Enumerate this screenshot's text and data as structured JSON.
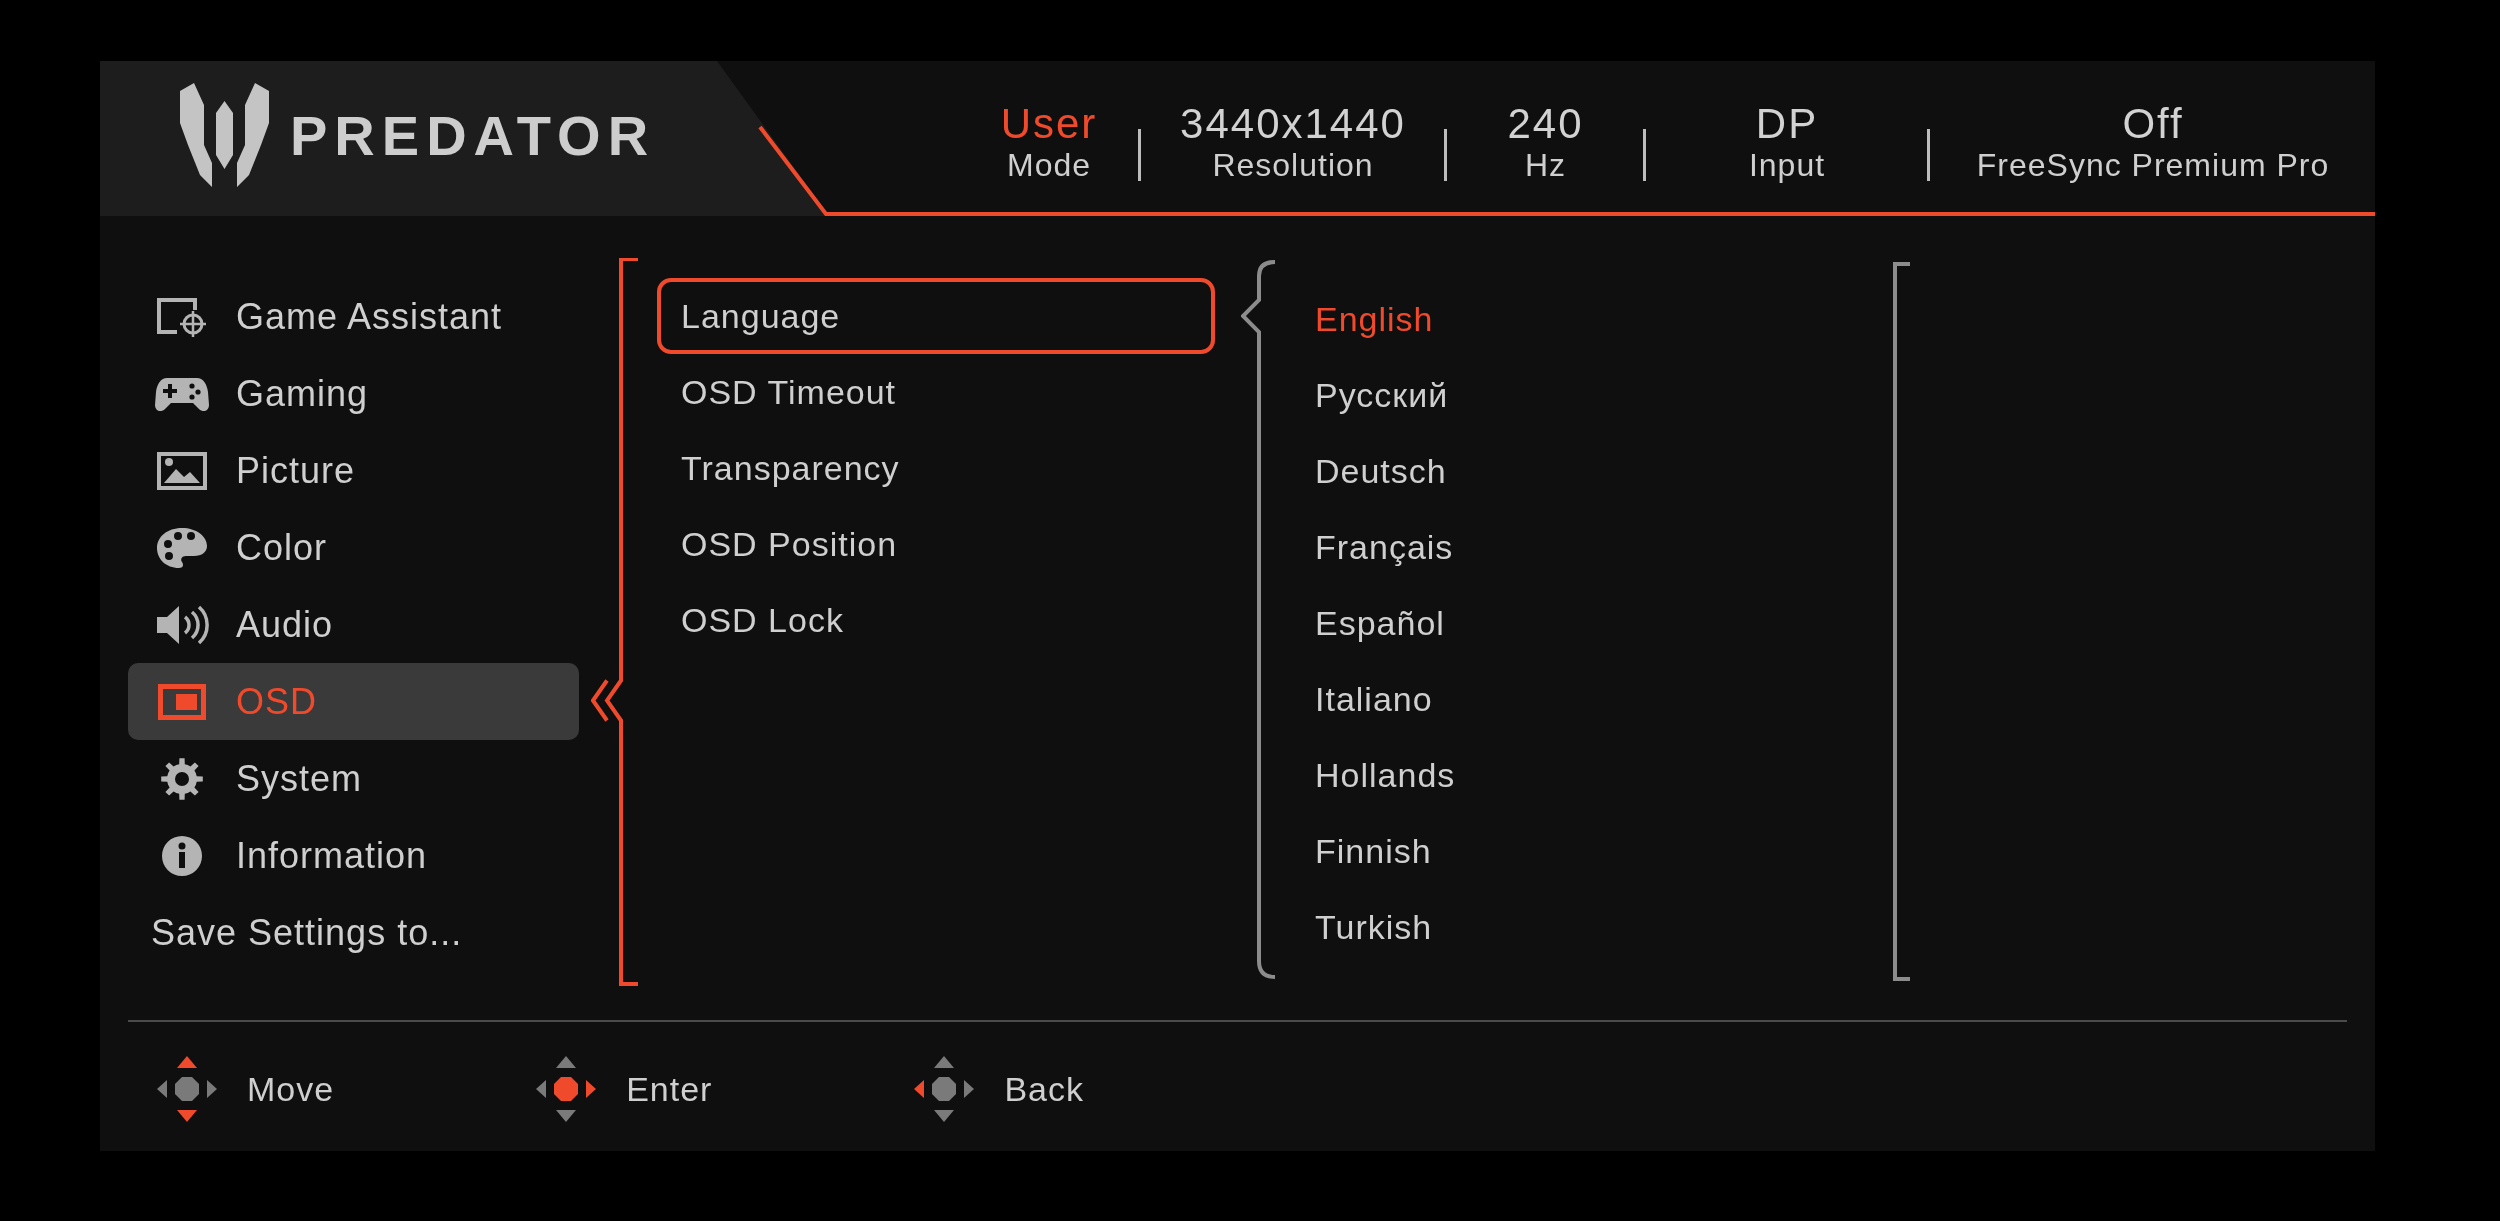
{
  "logo": {
    "wordmark": "PREDATOR"
  },
  "status_bar": [
    {
      "value": "User",
      "label": "Mode",
      "highlighted": true
    },
    {
      "value": "3440x1440",
      "label": "Resolution",
      "highlighted": false
    },
    {
      "value": "240",
      "label": "Hz",
      "highlighted": false
    },
    {
      "value": "DP",
      "label": "Input",
      "highlighted": false
    },
    {
      "value": "Off",
      "label": "FreeSync Premium Pro",
      "highlighted": false
    }
  ],
  "menu": [
    {
      "label": "Game Assistant",
      "kind": "category",
      "selected": false
    },
    {
      "label": "Gaming",
      "kind": "category",
      "selected": false
    },
    {
      "label": "Picture",
      "kind": "category",
      "selected": false
    },
    {
      "label": "Color",
      "kind": "category",
      "selected": false
    },
    {
      "label": "Audio",
      "kind": "category",
      "selected": false
    },
    {
      "label": "OSD",
      "kind": "category",
      "selected": true
    },
    {
      "label": "System",
      "kind": "category",
      "selected": false
    },
    {
      "label": "Information",
      "kind": "category",
      "selected": false
    },
    {
      "label": "Save Settings to...",
      "kind": "action",
      "selected": false
    }
  ],
  "submenu": [
    {
      "label": "Language",
      "selected": true
    },
    {
      "label": "OSD Timeout",
      "selected": false
    },
    {
      "label": "Transparency",
      "selected": false
    },
    {
      "label": "OSD Position",
      "selected": false
    },
    {
      "label": "OSD Lock",
      "selected": false
    }
  ],
  "options": [
    {
      "label": "English",
      "selected": true
    },
    {
      "label": "Русский",
      "selected": false
    },
    {
      "label": "Deutsch",
      "selected": false
    },
    {
      "label": "Français",
      "selected": false
    },
    {
      "label": "Español",
      "selected": false
    },
    {
      "label": "Italiano",
      "selected": false
    },
    {
      "label": "Hollands",
      "selected": false
    },
    {
      "label": "Finnish",
      "selected": false
    },
    {
      "label": "Turkish",
      "selected": false
    }
  ],
  "hints": [
    {
      "label": "Move",
      "kind": "move"
    },
    {
      "label": "Enter",
      "kind": "enter"
    },
    {
      "label": "Back",
      "kind": "back"
    }
  ]
}
